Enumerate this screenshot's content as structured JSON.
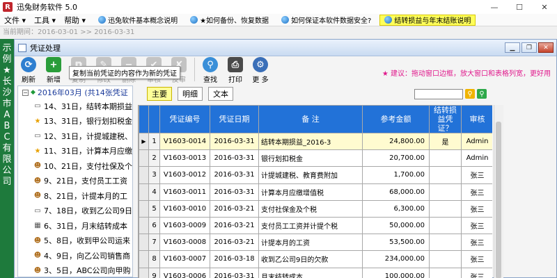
{
  "app": {
    "title": "迅兔财务软件 5.0",
    "logo": "R"
  },
  "menu": [
    "文件",
    "工具",
    "帮助"
  ],
  "quick_links": [
    {
      "label": "迅兔软件基本概念说明",
      "highlight": false
    },
    {
      "label": "★如何备份、恢复数据",
      "highlight": false
    },
    {
      "label": "如何保证本软件数据安全?",
      "highlight": false
    },
    {
      "label": "结转损益与年末结账说明",
      "highlight": true
    }
  ],
  "period": "当前期间：2016-03-01 >> 2016-03-31",
  "company_vertical": [
    "示",
    "例",
    "★",
    "长",
    "沙",
    "市",
    "A",
    "B",
    "C",
    "有",
    "限",
    "公",
    "司"
  ],
  "window": {
    "title": "凭证处理"
  },
  "toolbar": [
    {
      "label": "刷新",
      "icon": "refresh-icon",
      "glyph": "⟳",
      "color": "#2f7fd0",
      "disabled": false
    },
    {
      "label": "新增",
      "icon": "add-icon",
      "glyph": "+",
      "color": "#2a9d3a",
      "disabled": false
    },
    {
      "label": "复制",
      "icon": "copy-icon",
      "glyph": "⧉",
      "color": "#6a6a6a",
      "disabled": true
    },
    {
      "label": "修改",
      "icon": "edit-icon",
      "glyph": "✎",
      "color": "#6a6a6a",
      "disabled": true
    },
    {
      "label": "删除",
      "icon": "delete-icon",
      "glyph": "−",
      "color": "#6a6a6a",
      "disabled": true
    },
    {
      "label": "审核",
      "icon": "approve-icon",
      "glyph": "✔",
      "color": "#6a6a6a",
      "disabled": true
    },
    {
      "label": "反审",
      "icon": "unapprove-icon",
      "glyph": "✘",
      "color": "#6a6a6a",
      "disabled": true
    },
    {
      "label": "查找",
      "icon": "search-icon",
      "glyph": "⚲",
      "color": "#3a8fd8",
      "disabled": false
    },
    {
      "label": "打印",
      "icon": "print-icon",
      "glyph": "⎙",
      "color": "#4a4a4a",
      "disabled": false
    },
    {
      "label": "更 多",
      "icon": "gear-icon",
      "glyph": "⚙",
      "color": "#3a6fb8",
      "disabled": false
    }
  ],
  "tooltip": "复制当前凭证的内容作为新的凭证",
  "tip": "★ 建议：拖动窗口边框，放大窗口和表格列宽，更好用",
  "tree": {
    "root": "2016年03月 (共14张凭证",
    "items": [
      {
        "text": "14、31日，结转本期损益",
        "icon": "doc-icon",
        "glyph": "▭"
      },
      {
        "text": "13、31日，银行划扣税金",
        "icon": "star-icon",
        "glyph": "★"
      },
      {
        "text": "12、31日，计提城建税、",
        "icon": "doc-icon",
        "glyph": "▭"
      },
      {
        "text": "11、31日，计算本月应缴",
        "icon": "star-icon",
        "glyph": "★"
      },
      {
        "text": "10、21日，支付社保及个",
        "icon": "user-icon",
        "glyph": "☻"
      },
      {
        "text": "9、21日，支付员工工资",
        "icon": "user-icon",
        "glyph": "☻"
      },
      {
        "text": "8、21日，计提本月的工",
        "icon": "user-icon",
        "glyph": "☻"
      },
      {
        "text": "7、18日，收到乙公司9日",
        "icon": "doc-icon",
        "glyph": "▭"
      },
      {
        "text": "6、31日，月末结转成本",
        "icon": "grid-icon",
        "glyph": "▦"
      },
      {
        "text": "5、8日，收到甲公司运来",
        "icon": "user-icon",
        "glyph": "☻"
      },
      {
        "text": "4、9日，向乙公司销售商",
        "icon": "user-icon",
        "glyph": "☻"
      },
      {
        "text": "3、5日，ABC公司向甲购",
        "icon": "user-icon",
        "glyph": "☻"
      }
    ]
  },
  "tabs": [
    "主要",
    "明细",
    "文本"
  ],
  "table": {
    "headers": [
      "凭证编号",
      "凭证日期",
      "备 注",
      "参考金额",
      "结转损益凭证？",
      "审核"
    ],
    "rows": [
      [
        "1",
        "V1603-0014",
        "2016-03-31",
        "结转本期损益_2016-3",
        "24,800.00",
        "是",
        "Admin"
      ],
      [
        "2",
        "V1603-0013",
        "2016-03-31",
        "银行划扣税金",
        "20,700.00",
        "",
        "Admin"
      ],
      [
        "3",
        "V1603-0012",
        "2016-03-31",
        "计提城建税、教育费附加",
        "1,700.00",
        "",
        "张三"
      ],
      [
        "4",
        "V1603-0011",
        "2016-03-31",
        "计算本月应缴增值税",
        "68,000.00",
        "",
        "张三"
      ],
      [
        "5",
        "V1603-0010",
        "2016-03-21",
        "支付社保金及个税",
        "6,300.00",
        "",
        "张三"
      ],
      [
        "6",
        "V1603-0009",
        "2016-03-21",
        "支付员工工资并计提个税",
        "50,000.00",
        "",
        "张三"
      ],
      [
        "7",
        "V1603-0008",
        "2016-03-21",
        "计提本月的工资",
        "53,500.00",
        "",
        "张三"
      ],
      [
        "8",
        "V1603-0007",
        "2016-03-18",
        "收到乙公司9日的欠款",
        "234,000.00",
        "",
        "张三"
      ],
      [
        "9",
        "V1603-0006",
        "2016-03-31",
        "月末结转成本",
        "100,000.00",
        "",
        "张三"
      ]
    ]
  }
}
